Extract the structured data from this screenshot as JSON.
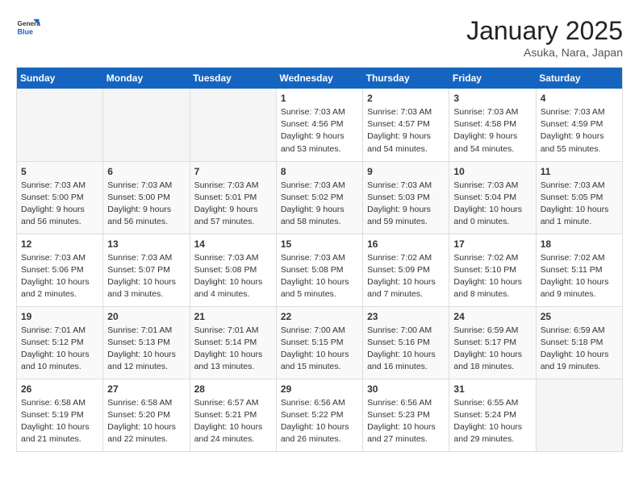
{
  "header": {
    "logo_general": "General",
    "logo_blue": "Blue",
    "title": "January 2025",
    "subtitle": "Asuka, Nara, Japan"
  },
  "weekdays": [
    "Sunday",
    "Monday",
    "Tuesday",
    "Wednesday",
    "Thursday",
    "Friday",
    "Saturday"
  ],
  "weeks": [
    [
      {
        "day": "",
        "info": ""
      },
      {
        "day": "",
        "info": ""
      },
      {
        "day": "",
        "info": ""
      },
      {
        "day": "1",
        "info": "Sunrise: 7:03 AM\nSunset: 4:56 PM\nDaylight: 9 hours and 53 minutes."
      },
      {
        "day": "2",
        "info": "Sunrise: 7:03 AM\nSunset: 4:57 PM\nDaylight: 9 hours and 54 minutes."
      },
      {
        "day": "3",
        "info": "Sunrise: 7:03 AM\nSunset: 4:58 PM\nDaylight: 9 hours and 54 minutes."
      },
      {
        "day": "4",
        "info": "Sunrise: 7:03 AM\nSunset: 4:59 PM\nDaylight: 9 hours and 55 minutes."
      }
    ],
    [
      {
        "day": "5",
        "info": "Sunrise: 7:03 AM\nSunset: 5:00 PM\nDaylight: 9 hours and 56 minutes."
      },
      {
        "day": "6",
        "info": "Sunrise: 7:03 AM\nSunset: 5:00 PM\nDaylight: 9 hours and 56 minutes."
      },
      {
        "day": "7",
        "info": "Sunrise: 7:03 AM\nSunset: 5:01 PM\nDaylight: 9 hours and 57 minutes."
      },
      {
        "day": "8",
        "info": "Sunrise: 7:03 AM\nSunset: 5:02 PM\nDaylight: 9 hours and 58 minutes."
      },
      {
        "day": "9",
        "info": "Sunrise: 7:03 AM\nSunset: 5:03 PM\nDaylight: 9 hours and 59 minutes."
      },
      {
        "day": "10",
        "info": "Sunrise: 7:03 AM\nSunset: 5:04 PM\nDaylight: 10 hours and 0 minutes."
      },
      {
        "day": "11",
        "info": "Sunrise: 7:03 AM\nSunset: 5:05 PM\nDaylight: 10 hours and 1 minute."
      }
    ],
    [
      {
        "day": "12",
        "info": "Sunrise: 7:03 AM\nSunset: 5:06 PM\nDaylight: 10 hours and 2 minutes."
      },
      {
        "day": "13",
        "info": "Sunrise: 7:03 AM\nSunset: 5:07 PM\nDaylight: 10 hours and 3 minutes."
      },
      {
        "day": "14",
        "info": "Sunrise: 7:03 AM\nSunset: 5:08 PM\nDaylight: 10 hours and 4 minutes."
      },
      {
        "day": "15",
        "info": "Sunrise: 7:03 AM\nSunset: 5:08 PM\nDaylight: 10 hours and 5 minutes."
      },
      {
        "day": "16",
        "info": "Sunrise: 7:02 AM\nSunset: 5:09 PM\nDaylight: 10 hours and 7 minutes."
      },
      {
        "day": "17",
        "info": "Sunrise: 7:02 AM\nSunset: 5:10 PM\nDaylight: 10 hours and 8 minutes."
      },
      {
        "day": "18",
        "info": "Sunrise: 7:02 AM\nSunset: 5:11 PM\nDaylight: 10 hours and 9 minutes."
      }
    ],
    [
      {
        "day": "19",
        "info": "Sunrise: 7:01 AM\nSunset: 5:12 PM\nDaylight: 10 hours and 10 minutes."
      },
      {
        "day": "20",
        "info": "Sunrise: 7:01 AM\nSunset: 5:13 PM\nDaylight: 10 hours and 12 minutes."
      },
      {
        "day": "21",
        "info": "Sunrise: 7:01 AM\nSunset: 5:14 PM\nDaylight: 10 hours and 13 minutes."
      },
      {
        "day": "22",
        "info": "Sunrise: 7:00 AM\nSunset: 5:15 PM\nDaylight: 10 hours and 15 minutes."
      },
      {
        "day": "23",
        "info": "Sunrise: 7:00 AM\nSunset: 5:16 PM\nDaylight: 10 hours and 16 minutes."
      },
      {
        "day": "24",
        "info": "Sunrise: 6:59 AM\nSunset: 5:17 PM\nDaylight: 10 hours and 18 minutes."
      },
      {
        "day": "25",
        "info": "Sunrise: 6:59 AM\nSunset: 5:18 PM\nDaylight: 10 hours and 19 minutes."
      }
    ],
    [
      {
        "day": "26",
        "info": "Sunrise: 6:58 AM\nSunset: 5:19 PM\nDaylight: 10 hours and 21 minutes."
      },
      {
        "day": "27",
        "info": "Sunrise: 6:58 AM\nSunset: 5:20 PM\nDaylight: 10 hours and 22 minutes."
      },
      {
        "day": "28",
        "info": "Sunrise: 6:57 AM\nSunset: 5:21 PM\nDaylight: 10 hours and 24 minutes."
      },
      {
        "day": "29",
        "info": "Sunrise: 6:56 AM\nSunset: 5:22 PM\nDaylight: 10 hours and 26 minutes."
      },
      {
        "day": "30",
        "info": "Sunrise: 6:56 AM\nSunset: 5:23 PM\nDaylight: 10 hours and 27 minutes."
      },
      {
        "day": "31",
        "info": "Sunrise: 6:55 AM\nSunset: 5:24 PM\nDaylight: 10 hours and 29 minutes."
      },
      {
        "day": "",
        "info": ""
      }
    ]
  ]
}
